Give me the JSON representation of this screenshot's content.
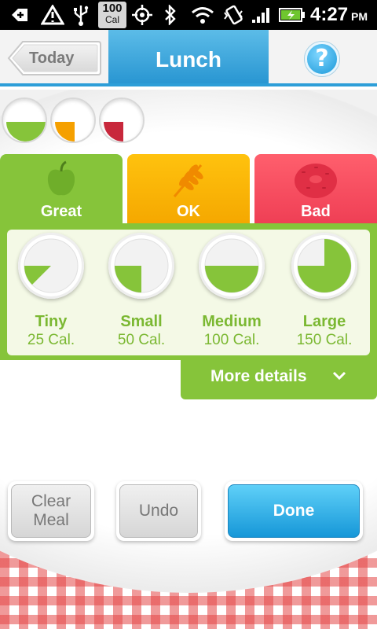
{
  "status_bar": {
    "calorie_badge_value": "100",
    "calorie_badge_unit": "Cal",
    "time": "4:27",
    "ampm": "PM"
  },
  "header": {
    "back_label": "Today",
    "title": "Lunch",
    "help_label": "?"
  },
  "meal_gauges": [
    {
      "category": "great",
      "color": "#86c43a",
      "fill": 0.5
    },
    {
      "category": "ok",
      "color": "#f5a000",
      "fill": 0.25
    },
    {
      "category": "bad",
      "color": "#c8283c",
      "fill": 0.25
    }
  ],
  "tabs": [
    {
      "label": "Great",
      "icon": "apple-icon",
      "color": "#86c43a",
      "selected": true
    },
    {
      "label": "OK",
      "icon": "wheat-icon",
      "color": "#ffb800",
      "selected": false
    },
    {
      "label": "Bad",
      "icon": "donut-icon",
      "color": "#f24b5c",
      "selected": false
    }
  ],
  "sizes": [
    {
      "name": "Tiny",
      "calories": "25 Cal.",
      "fill": 0.125
    },
    {
      "name": "Small",
      "calories": "50 Cal.",
      "fill": 0.25
    },
    {
      "name": "Medium",
      "calories": "100 Cal.",
      "fill": 0.5
    },
    {
      "name": "Large",
      "calories": "150 Cal.",
      "fill": 0.75
    }
  ],
  "more_details_label": "More details",
  "buttons": {
    "clear_line1": "Clear",
    "clear_line2": "Meal",
    "undo": "Undo",
    "done": "Done"
  },
  "colors": {
    "accent_blue": "#2d9ed8",
    "great_green": "#86c43a",
    "ok_yellow": "#ffc20e",
    "bad_red": "#f24b5c"
  }
}
